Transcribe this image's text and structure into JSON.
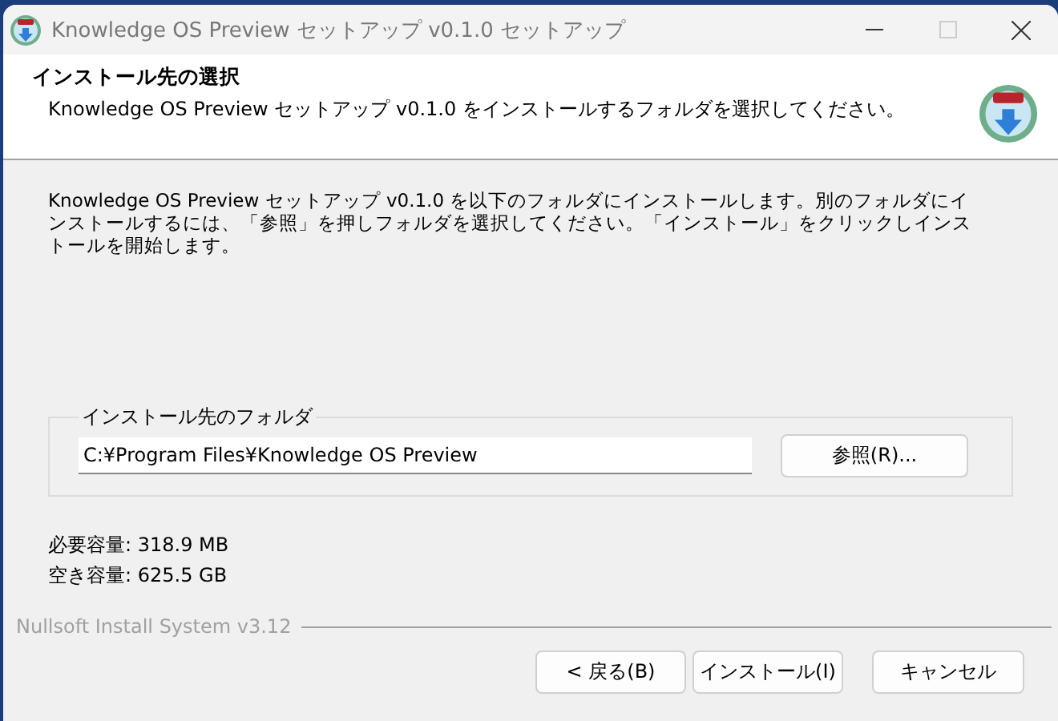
{
  "window": {
    "title": "Knowledge OS Preview セットアップ v0.1.0 セットアップ"
  },
  "header": {
    "title": "インストール先の選択",
    "subtitle": "Knowledge OS Preview セットアップ v0.1.0 をインストールするフォルダを選択してください。"
  },
  "description": "Knowledge OS Preview セットアップ v0.1.0 を以下のフォルダにインストールします。別のフォルダにインストールするには、「参照」を押しフォルダを選択してください。「インストール」をクリックしインストールを開始します。",
  "folder_group": {
    "label": "インストール先のフォルダ",
    "path": "C:¥Program Files¥Knowledge OS Preview",
    "browse_button": "参照(R)..."
  },
  "space": {
    "required": "必要容量: 318.9 MB",
    "available": "空き容量: 625.5 GB"
  },
  "branding": "Nullsoft Install System v3.12",
  "buttons": [
    {
      "label": "< 戻る(B)",
      "kind": "back"
    },
    {
      "label": "インストール(I)",
      "kind": "primary"
    },
    {
      "label": "キャンセル",
      "kind": "cancel"
    }
  ]
}
